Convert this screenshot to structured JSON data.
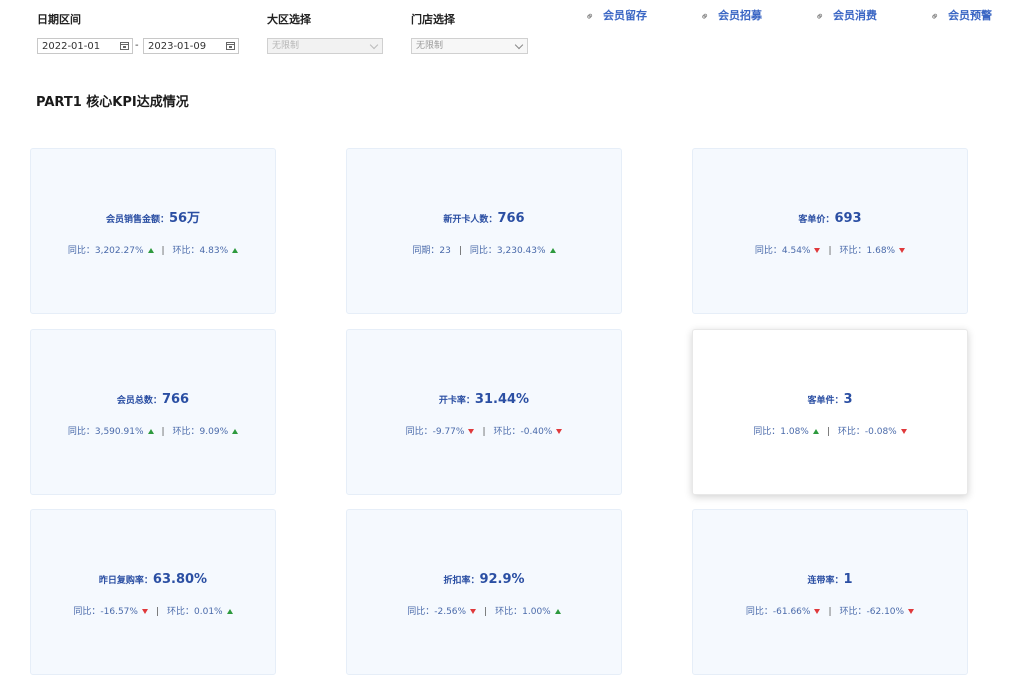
{
  "filters": {
    "date_label": "日期区间",
    "date_start": "2022-01-01",
    "date_separator": "-",
    "date_end": "2023-01-09",
    "region_label": "大区选择",
    "region_value": "无限制",
    "store_label": "门店选择",
    "store_value": "无限制"
  },
  "links": [
    {
      "label": "会员留存"
    },
    {
      "label": "会员招募"
    },
    {
      "label": "会员消费"
    },
    {
      "label": "会员预警"
    }
  ],
  "section": {
    "title": "PART1 核心KPI达成情况"
  },
  "kpis": [
    {
      "label": "会员销售金额：",
      "value": "56万",
      "stat1": "同比：3,202.27%",
      "stat1_dir": "up",
      "stat2": "环比：4.83%",
      "stat2_dir": "up"
    },
    {
      "label": "新开卡人数：",
      "value": "766",
      "stat1": "同期：23",
      "stat1_dir": "none",
      "stat2": "同比：3,230.43%",
      "stat2_dir": "up"
    },
    {
      "label": "客单价：",
      "value": "693",
      "stat1": "同比：4.54%",
      "stat1_dir": "down",
      "stat2": "环比：1.68%",
      "stat2_dir": "down"
    },
    {
      "label": "会员总数：",
      "value": "766",
      "stat1": "同比：3,590.91%",
      "stat1_dir": "up",
      "stat2": "环比：9.09%",
      "stat2_dir": "up"
    },
    {
      "label": "开卡率：",
      "value": "31.44%",
      "stat1": "同比：-9.77%",
      "stat1_dir": "down",
      "stat2": "环比：-0.40%",
      "stat2_dir": "down"
    },
    {
      "label": "客单件：",
      "value": "3",
      "stat1": "同比：1.08%",
      "stat1_dir": "up",
      "stat2": "环比：-0.08%",
      "stat2_dir": "down"
    },
    {
      "label": "昨日复购率：",
      "value": "63.80%",
      "stat1": "同比：-16.57%",
      "stat1_dir": "down",
      "stat2": "环比：0.01%",
      "stat2_dir": "up"
    },
    {
      "label": "折扣率：",
      "value": "92.9%",
      "stat1": "同比：-2.56%",
      "stat1_dir": "down",
      "stat2": "环比：1.00%",
      "stat2_dir": "up"
    },
    {
      "label": "连带率：",
      "value": "1",
      "stat1": "同比：-61.66%",
      "stat1_dir": "down",
      "stat2": "环比：-62.10%",
      "stat2_dir": "down"
    }
  ],
  "stat_separator": "|",
  "colors": {
    "accent": "#3a66c4",
    "up": "#2e9a3e",
    "down": "#e0393b",
    "card_bg": "#f5f9fe"
  }
}
